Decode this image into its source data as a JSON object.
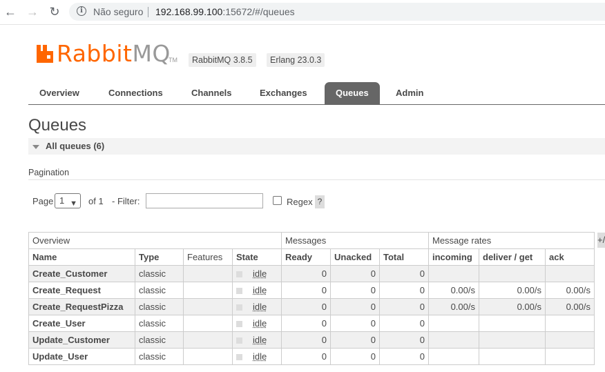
{
  "browser": {
    "insecure_label": "Não seguro",
    "url_host": "192.168.99.100",
    "url_rest": ":15672/#/queues"
  },
  "header": {
    "logo_rabbit": "Rabbit",
    "logo_mq": "MQ",
    "logo_tm": "TM",
    "version": "RabbitMQ 3.8.5",
    "erlang": "Erlang 23.0.3",
    "brand_color": "#ff6600"
  },
  "tabs": [
    {
      "label": "Overview"
    },
    {
      "label": "Connections"
    },
    {
      "label": "Channels"
    },
    {
      "label": "Exchanges"
    },
    {
      "label": "Queues"
    },
    {
      "label": "Admin"
    }
  ],
  "page": {
    "title": "Queues",
    "section_label": "All queues (6)"
  },
  "pagination": {
    "title": "Pagination",
    "page_label": "Page",
    "page_value": "1",
    "of_label": "of 1",
    "filter_label": "- Filter:",
    "filter_value": "",
    "regex_label": "Regex",
    "help_label": "?"
  },
  "table": {
    "groups": [
      "Overview",
      "Messages",
      "Message rates"
    ],
    "columns": [
      "Name",
      "Type",
      "Features",
      "State",
      "Ready",
      "Unacked",
      "Total",
      "incoming",
      "deliver / get",
      "ack"
    ],
    "plus_label": "+/-",
    "rows": [
      {
        "name": "Create_Customer",
        "type": "classic",
        "features": "",
        "state": "idle",
        "ready": "0",
        "unacked": "0",
        "total": "0",
        "incoming": "",
        "deliver": "",
        "ack": ""
      },
      {
        "name": "Create_Request",
        "type": "classic",
        "features": "",
        "state": "idle",
        "ready": "0",
        "unacked": "0",
        "total": "0",
        "incoming": "0.00/s",
        "deliver": "0.00/s",
        "ack": "0.00/s"
      },
      {
        "name": "Create_RequestPizza",
        "type": "classic",
        "features": "",
        "state": "idle",
        "ready": "0",
        "unacked": "0",
        "total": "0",
        "incoming": "0.00/s",
        "deliver": "0.00/s",
        "ack": "0.00/s"
      },
      {
        "name": "Create_User",
        "type": "classic",
        "features": "",
        "state": "idle",
        "ready": "0",
        "unacked": "0",
        "total": "0",
        "incoming": "",
        "deliver": "",
        "ack": ""
      },
      {
        "name": "Update_Customer",
        "type": "classic",
        "features": "",
        "state": "idle",
        "ready": "0",
        "unacked": "0",
        "total": "0",
        "incoming": "",
        "deliver": "",
        "ack": ""
      },
      {
        "name": "Update_User",
        "type": "classic",
        "features": "",
        "state": "idle",
        "ready": "0",
        "unacked": "0",
        "total": "0",
        "incoming": "",
        "deliver": "",
        "ack": ""
      }
    ]
  }
}
